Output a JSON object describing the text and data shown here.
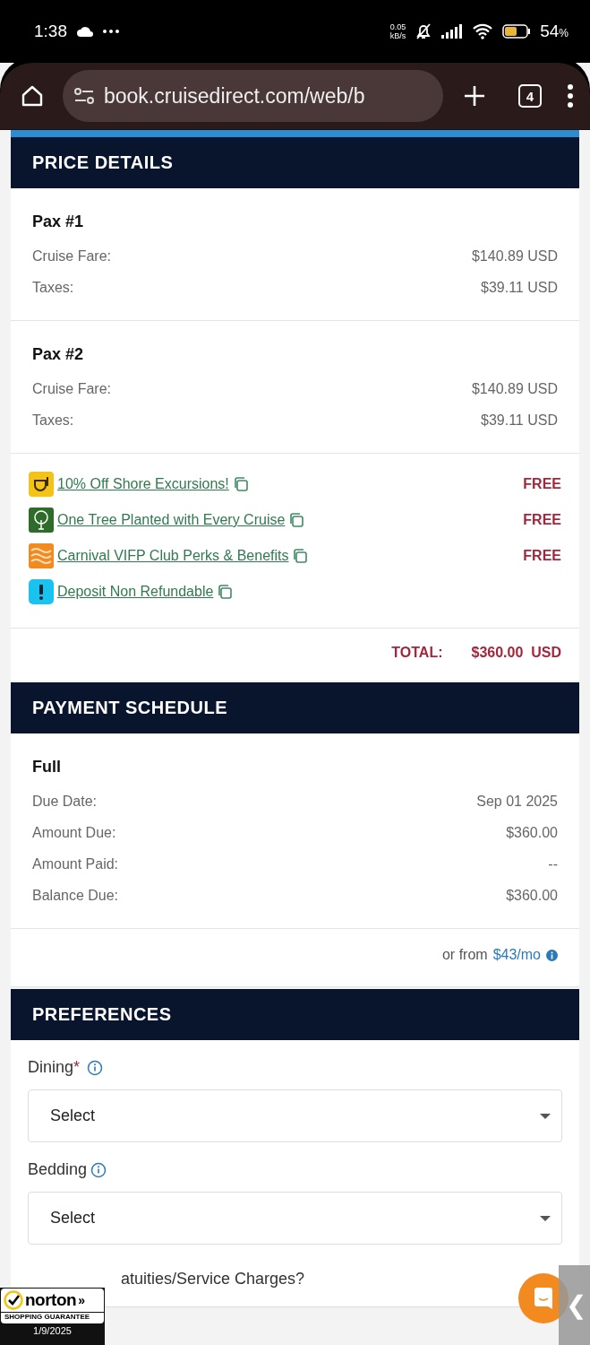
{
  "status_bar": {
    "time": "1:38",
    "net_speed": "0.05",
    "net_unit": "kB/s",
    "battery_percent": "54",
    "percent_sign": "%"
  },
  "browser": {
    "url": "book.cruisedirect.com/web/b",
    "tab_count": "4"
  },
  "price_details": {
    "title": "PRICE DETAILS",
    "passengers": [
      {
        "name": "Pax #1",
        "lines": [
          {
            "label": "Cruise Fare:",
            "value": "$140.89 USD"
          },
          {
            "label": "Taxes:",
            "value": "$39.11 USD"
          }
        ]
      },
      {
        "name": "Pax #2",
        "lines": [
          {
            "label": "Cruise Fare:",
            "value": "$140.89 USD"
          },
          {
            "label": "Taxes:",
            "value": "$39.11 USD"
          }
        ]
      }
    ],
    "perks": [
      {
        "kind": "excursion",
        "label": "10% Off Shore Excursions!",
        "price": "FREE"
      },
      {
        "kind": "tree",
        "label": "One Tree Planted with Every Cruise",
        "price": "FREE"
      },
      {
        "kind": "waves",
        "label": "Carnival VIFP Club Perks & Benefits",
        "price": "FREE"
      },
      {
        "kind": "alert",
        "label": "Deposit Non Refundable"
      }
    ],
    "total_label": "TOTAL:",
    "total_value": "$360.00  USD"
  },
  "payment_schedule": {
    "title": "PAYMENT SCHEDULE",
    "plan": "Full",
    "lines": [
      {
        "label": "Due Date:",
        "value": "Sep 01 2025"
      },
      {
        "label": "Amount Due:",
        "value": "$360.00"
      },
      {
        "label": "Amount Paid:",
        "value": "--"
      },
      {
        "label": "Balance Due:",
        "value": "$360.00"
      }
    ],
    "financing_prefix": "or from",
    "financing_link": "$43/mo"
  },
  "preferences": {
    "title": "PREFERENCES",
    "fields": [
      {
        "label": "Dining",
        "required_mark": "*",
        "placeholder": "Select"
      },
      {
        "label": "Bedding",
        "placeholder": "Select"
      }
    ],
    "partial_question": "atuities/Service Charges?"
  },
  "norton_badge": {
    "brand": "norton",
    "arrows": "»",
    "tagline": "SHOPPING GUARANTEE",
    "date": "1/9/2025"
  },
  "side_tab": {
    "arrow": "❮"
  }
}
